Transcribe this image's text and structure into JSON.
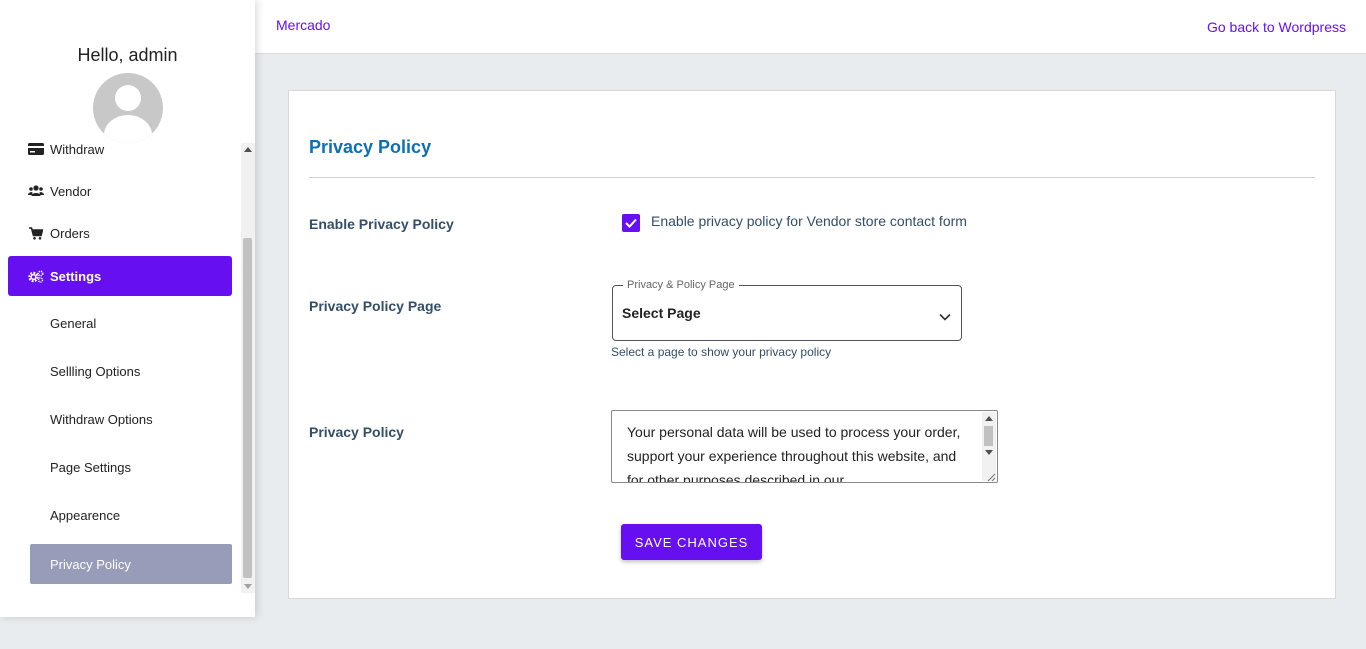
{
  "header": {
    "brand": "Mercado",
    "back_link": "Go back to Wordpress"
  },
  "sidebar": {
    "greeting": "Hello, admin",
    "items": [
      {
        "label": "Withdraw",
        "icon": "credit-card-icon"
      },
      {
        "label": "Vendor",
        "icon": "users-icon"
      },
      {
        "label": "Orders",
        "icon": "cart-icon"
      },
      {
        "label": "Settings",
        "icon": "gears-icon",
        "active": true
      }
    ],
    "sub_items": [
      {
        "label": "General"
      },
      {
        "label": "Sellling Options"
      },
      {
        "label": "Withdraw Options"
      },
      {
        "label": "Page Settings"
      },
      {
        "label": "Appearence"
      },
      {
        "label": "Privacy Policy",
        "selected": true
      }
    ]
  },
  "main": {
    "title": "Privacy Policy",
    "enable": {
      "label": "Enable Privacy Policy",
      "checkbox_text": "Enable privacy policy for Vendor store contact form",
      "checked": true
    },
    "page": {
      "label": "Privacy Policy Page",
      "legend": "Privacy & Policy Page",
      "value": "Select Page",
      "help": "Select a page to show your privacy policy"
    },
    "policy": {
      "label": "Privacy Policy",
      "text": "Your personal data will be used to process your order, support your experience throughout this website, and for other purposes described in our"
    },
    "save_label": "SAVE CHANGES"
  },
  "colors": {
    "accent": "#6610f2",
    "title": "#0f6fb5",
    "selected_sub": "#979cb8"
  }
}
